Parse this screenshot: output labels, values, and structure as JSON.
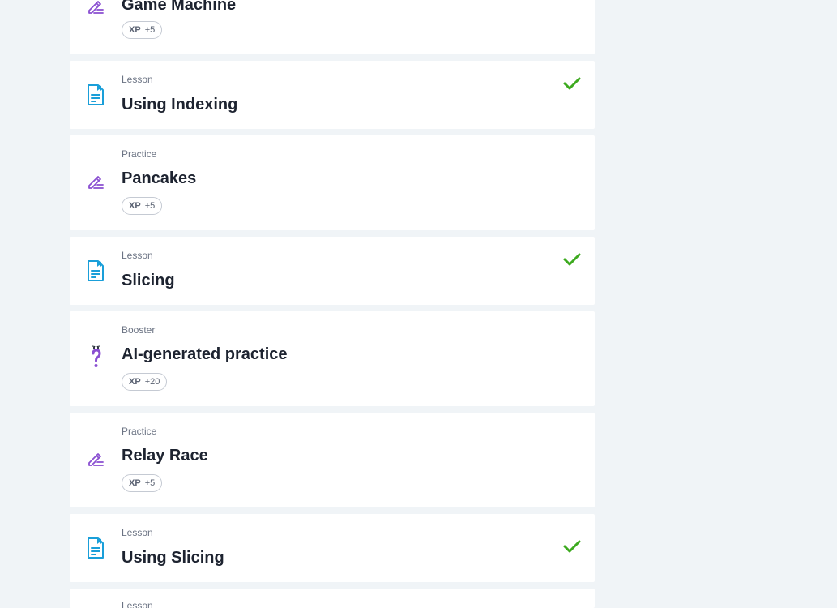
{
  "items": [
    {
      "type": "",
      "title": "Game Machine",
      "icon": "pencil-icon",
      "xp_label": "XP",
      "xp_value": "+5",
      "completed": false
    },
    {
      "type": "Lesson",
      "title": "Using Indexing",
      "icon": "lesson-document-icon",
      "completed": true
    },
    {
      "type": "Practice",
      "title": "Pancakes",
      "icon": "pencil-icon",
      "xp_label": "XP",
      "xp_value": "+5",
      "completed": false
    },
    {
      "type": "Lesson",
      "title": "Slicing",
      "icon": "lesson-document-icon",
      "completed": true
    },
    {
      "type": "Booster",
      "title": "AI-generated practice",
      "icon": "question-mark-icon",
      "xp_label": "XP",
      "xp_value": "+20",
      "completed": false
    },
    {
      "type": "Practice",
      "title": "Relay Race",
      "icon": "pencil-icon",
      "xp_label": "XP",
      "xp_value": "+5",
      "completed": false
    },
    {
      "type": "Lesson",
      "title": "Using Slicing",
      "icon": "lesson-document-icon",
      "completed": true
    },
    {
      "type": "Lesson",
      "title": "",
      "icon": "lesson-document-icon",
      "completed": false
    }
  ],
  "colors": {
    "background": "#f0f4f7",
    "lesson_icon": "#1a9fd9",
    "practice_icon": "#8a4fd1",
    "check": "#3daa1f",
    "title": "#1d2330"
  }
}
